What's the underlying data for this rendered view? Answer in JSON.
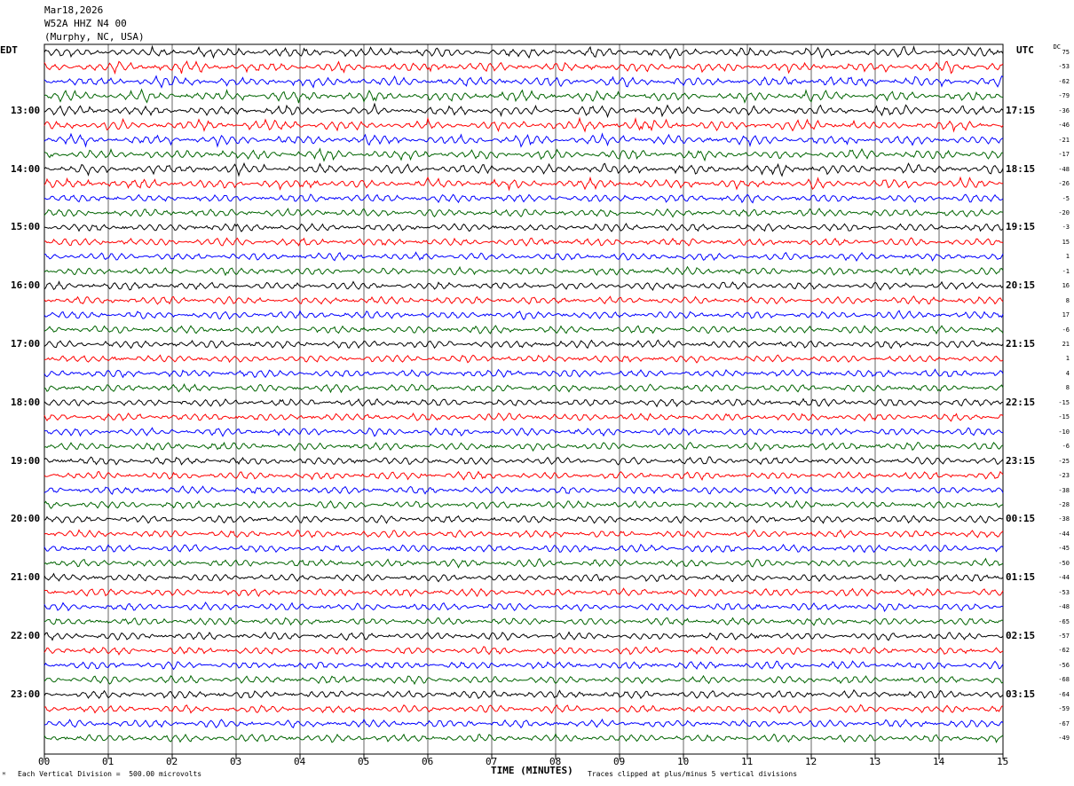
{
  "header": {
    "date": "Mar18,2026",
    "station": "W52A HHZ N4 00",
    "location": "(Murphy, NC, USA)"
  },
  "left_timezone": "EDT",
  "right_timezone": "UTC",
  "dc_label": "DC",
  "footer": {
    "scale_text": "Each Vertical Division =  500.00 microvolts",
    "clip_text": "Traces clipped at plus/minus 5 vertical divisions",
    "corner_mark": "ᴹ"
  },
  "colors": {
    "series": [
      "#000000",
      "#ff0000",
      "#0000ff",
      "#006400"
    ],
    "grid": "#000000"
  },
  "chart_data": {
    "type": "line",
    "title": "Mar18,2026 W52A HHZ N4 00 (Murphy, NC, USA)",
    "xlabel": "TIME (MINUTES)",
    "xlim": [
      0,
      15
    ],
    "x_ticks": [
      "00",
      "01",
      "02",
      "03",
      "04",
      "05",
      "06",
      "07",
      "08",
      "09",
      "10",
      "11",
      "12",
      "13",
      "14",
      "15"
    ],
    "left_hour_labels": [
      "13:00",
      "14:00",
      "15:00",
      "16:00",
      "17:00",
      "18:00",
      "19:00",
      "20:00",
      "21:00",
      "22:00",
      "23:00"
    ],
    "right_hour_labels": [
      "17:15",
      "18:15",
      "19:15",
      "20:15",
      "21:15",
      "22:15",
      "23:15",
      "00:15",
      "01:15",
      "02:15",
      "03:15"
    ],
    "first_labeled_trace": 4,
    "trace_count": 48,
    "dc_offsets": [
      75,
      -53,
      -62,
      -79,
      -36,
      -46,
      -21,
      -17,
      -48,
      -26,
      -5,
      -20,
      -3,
      15,
      1,
      -1,
      16,
      8,
      17,
      -6,
      21,
      1,
      4,
      8,
      -15,
      -15,
      -10,
      -6,
      -25,
      -23,
      -38,
      -28,
      -38,
      -44,
      -45,
      -50,
      -44,
      -53,
      -48,
      -65,
      -57,
      -62,
      -56,
      -68,
      -64,
      -59,
      -67,
      -49
    ],
    "clip_divisions": 5,
    "division_microvolts": 500.0
  }
}
